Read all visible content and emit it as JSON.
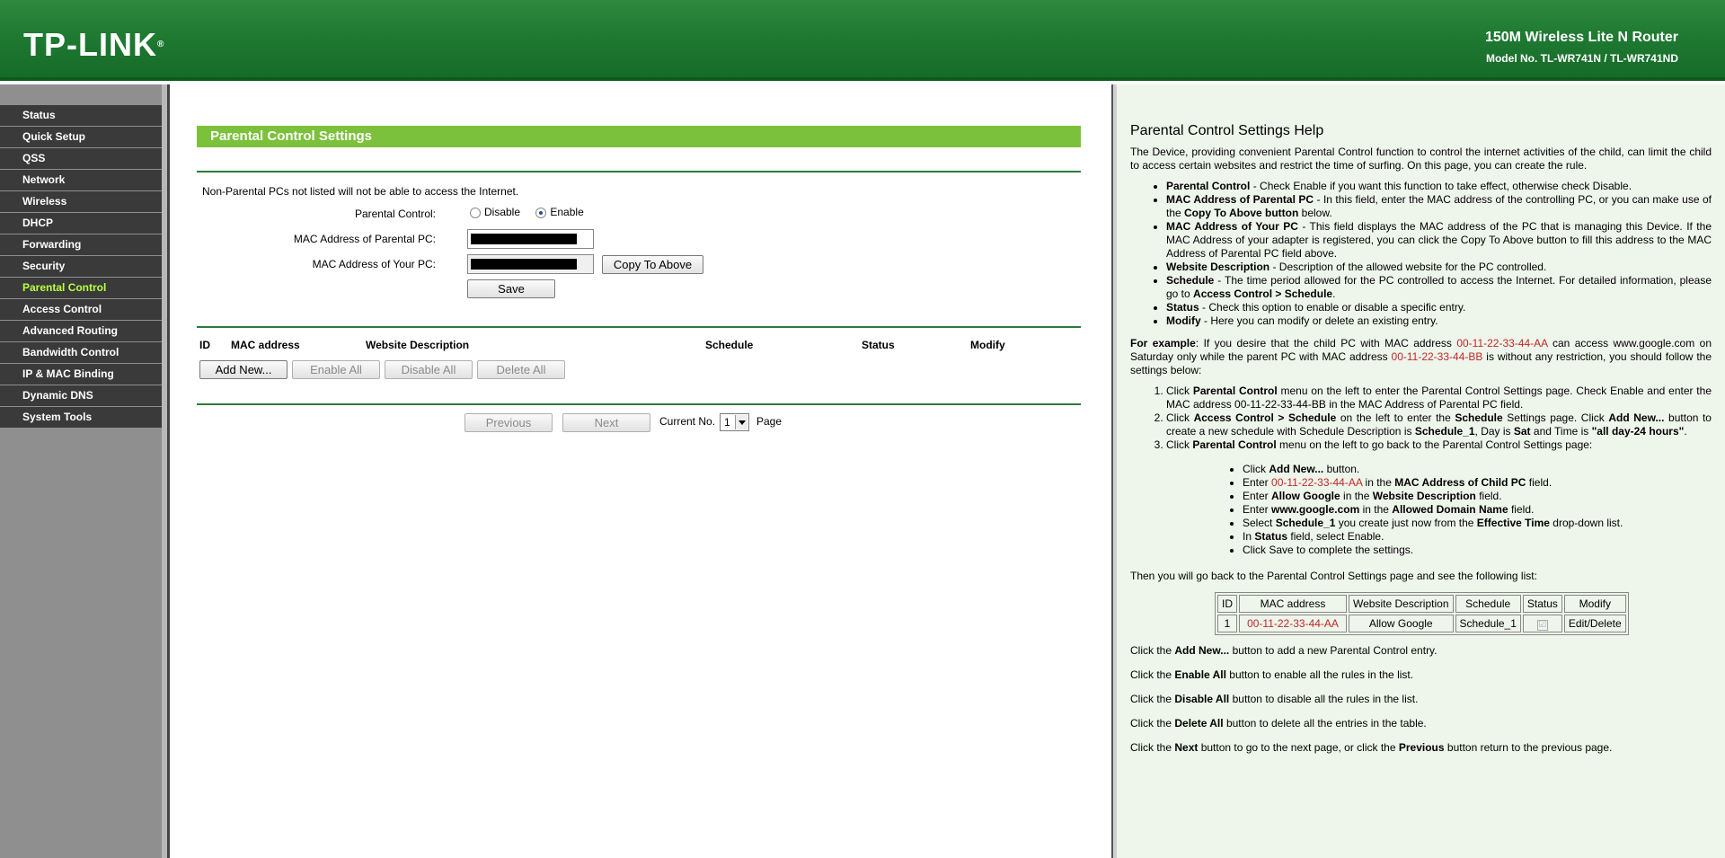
{
  "header": {
    "logo": "TP-LINK",
    "logo_mark": "®",
    "product_title": "150M Wireless Lite N Router",
    "model": "Model No. TL-WR741N / TL-WR741ND"
  },
  "sidebar": {
    "items": [
      {
        "label": "Status"
      },
      {
        "label": "Quick Setup"
      },
      {
        "label": "QSS"
      },
      {
        "label": "Network"
      },
      {
        "label": "Wireless"
      },
      {
        "label": "DHCP"
      },
      {
        "label": "Forwarding"
      },
      {
        "label": "Security"
      },
      {
        "label": "Parental Control",
        "active": true
      },
      {
        "label": "Access Control"
      },
      {
        "label": "Advanced Routing"
      },
      {
        "label": "Bandwidth Control"
      },
      {
        "label": "IP & MAC Binding"
      },
      {
        "label": "Dynamic DNS"
      },
      {
        "label": "System Tools"
      }
    ]
  },
  "main": {
    "title": "Parental Control Settings",
    "note": "Non-Parental PCs not listed will not be able to access the Internet.",
    "parental_control_label": "Parental Control:",
    "disable_label": "Disable",
    "enable_label": "Enable",
    "selected": "Enable",
    "mac_parent_label": "MAC Address of Parental PC:",
    "mac_yours_label": "MAC Address of Your PC:",
    "copy_button": "Copy To Above",
    "save_button": "Save",
    "table_headers": {
      "id": "ID",
      "mac": "MAC address",
      "website": "Website Description",
      "schedule": "Schedule",
      "status": "Status",
      "modify": "Modify"
    },
    "add_new": "Add New...",
    "enable_all": "Enable All",
    "disable_all": "Disable All",
    "delete_all": "Delete All",
    "previous": "Previous",
    "next": "Next",
    "current_no": "Current No.",
    "page_value": "1",
    "page_label": "Page"
  },
  "help": {
    "title": "Parental Control Settings Help",
    "intro": "The Device, providing convenient Parental Control function to control the internet activities of the child, can limit the child to access certain websites and restrict the time of surfing. On this page, you can create the rule.",
    "example_mac_child": "00-11-22-33-44-AA",
    "example_mac_parent": "00-11-22-33-44-BB",
    "table": {
      "headers": [
        "ID",
        "MAC address",
        "Website Description",
        "Schedule",
        "Status",
        "Modify"
      ],
      "row": [
        "1",
        "00-11-22-33-44-AA",
        "Allow Google",
        "Schedule_1",
        "☑",
        "Edit/Delete"
      ]
    }
  }
}
